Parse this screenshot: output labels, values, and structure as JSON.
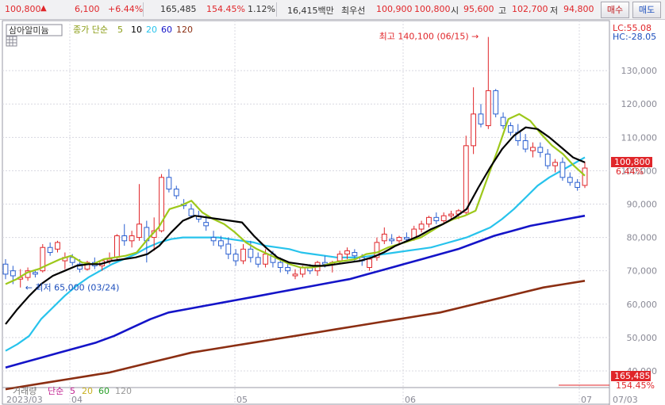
{
  "top_bar": {
    "price": "100,800",
    "up_arrow": "▲",
    "change": "6,100",
    "change_pct": "+6.44%",
    "volume": "165,485",
    "volume_ratio": "154.45%",
    "turnover": "1.12%",
    "trade_value": "16,415백만",
    "bid_label": "최우선",
    "ask1": "100,900",
    "bid1": "100,800",
    "open_label": "시",
    "open": "95,600",
    "high_label": "고",
    "high": "102,700",
    "low_label": "저",
    "low": "94,800",
    "buy_button": "매수",
    "sell_button": "매도"
  },
  "toolbar": {
    "name_chip": "삼아알미늄",
    "ma_label": "종가 단순",
    "ma_periods": [
      "5",
      "10",
      "20",
      "60",
      "120"
    ],
    "lc": "LC:55.08",
    "hc": "HC:-28.05"
  },
  "colors": {
    "up": "#e0262a",
    "down": "#2a5fd0",
    "ma5": "#9dc81a",
    "ma10": "#000000",
    "ma20": "#27c3ec",
    "ma60": "#1414c8",
    "ma120": "#8b2e12",
    "price_box": "#e0262a"
  },
  "chart_data": {
    "type": "candlestick",
    "y_ticks": [
      "130,000",
      "120,000",
      "110,000",
      "100,000",
      "90,000",
      "80,000",
      "70,000",
      "60,000",
      "50,000",
      "40,000"
    ],
    "ylim": [
      35000,
      145000
    ],
    "x_ticks": [
      "2023/03",
      "04",
      "05",
      "06",
      "07"
    ],
    "date_range": "2023/03 - 2023/07",
    "annotations": {
      "high": "최고 140,100 (06/15)",
      "low": "최저 65,000 (03/24)"
    },
    "current_price_label": "100,800",
    "current_change_label": "6.44%",
    "candles": [
      {
        "o": 72000,
        "h": 73500,
        "l": 67500,
        "c": 69000
      },
      {
        "o": 70000,
        "h": 71500,
        "l": 66000,
        "c": 68500
      },
      {
        "o": 67500,
        "h": 70500,
        "l": 65000,
        "c": 68000
      },
      {
        "o": 68000,
        "h": 71000,
        "l": 67000,
        "c": 70000
      },
      {
        "o": 69500,
        "h": 70500,
        "l": 68000,
        "c": 69000
      },
      {
        "o": 70000,
        "h": 78000,
        "l": 69500,
        "c": 77000
      },
      {
        "o": 77000,
        "h": 78500,
        "l": 74500,
        "c": 75500
      },
      {
        "o": 76500,
        "h": 79000,
        "l": 75500,
        "c": 78500
      },
      {
        "o": 73000,
        "h": 75500,
        "l": 70500,
        "c": 74000
      },
      {
        "o": 74000,
        "h": 75000,
        "l": 71500,
        "c": 72500
      },
      {
        "o": 72000,
        "h": 73500,
        "l": 69500,
        "c": 70500
      },
      {
        "o": 70500,
        "h": 73000,
        "l": 70000,
        "c": 72500
      },
      {
        "o": 72500,
        "h": 74000,
        "l": 70500,
        "c": 71500
      },
      {
        "o": 71500,
        "h": 73500,
        "l": 70000,
        "c": 73000
      },
      {
        "o": 73000,
        "h": 75500,
        "l": 72000,
        "c": 73500
      },
      {
        "o": 74000,
        "h": 81000,
        "l": 73500,
        "c": 80500
      },
      {
        "o": 80500,
        "h": 84000,
        "l": 77500,
        "c": 79000
      },
      {
        "o": 79000,
        "h": 82000,
        "l": 77000,
        "c": 80500
      },
      {
        "o": 80000,
        "h": 96000,
        "l": 79000,
        "c": 84000
      },
      {
        "o": 83000,
        "h": 85000,
        "l": 72500,
        "c": 79000
      },
      {
        "o": 80000,
        "h": 86000,
        "l": 76000,
        "c": 82000
      },
      {
        "o": 82000,
        "h": 99000,
        "l": 81500,
        "c": 98000
      },
      {
        "o": 98000,
        "h": 100500,
        "l": 93500,
        "c": 94500
      },
      {
        "o": 94500,
        "h": 95500,
        "l": 91500,
        "c": 92500
      },
      {
        "o": 90000,
        "h": 91500,
        "l": 88500,
        "c": 89500
      },
      {
        "o": 88500,
        "h": 90000,
        "l": 86000,
        "c": 86500
      },
      {
        "o": 86500,
        "h": 88000,
        "l": 84500,
        "c": 85500
      },
      {
        "o": 84500,
        "h": 86500,
        "l": 82000,
        "c": 83500
      },
      {
        "o": 80000,
        "h": 82000,
        "l": 77500,
        "c": 79000
      },
      {
        "o": 79000,
        "h": 80500,
        "l": 76500,
        "c": 77500
      },
      {
        "o": 78000,
        "h": 80000,
        "l": 73500,
        "c": 75000
      },
      {
        "o": 75000,
        "h": 76500,
        "l": 71500,
        "c": 73000
      },
      {
        "o": 73000,
        "h": 78000,
        "l": 72000,
        "c": 76500
      },
      {
        "o": 76500,
        "h": 79000,
        "l": 72500,
        "c": 74000
      },
      {
        "o": 74000,
        "h": 75500,
        "l": 71000,
        "c": 72000
      },
      {
        "o": 72000,
        "h": 76500,
        "l": 71000,
        "c": 75000
      },
      {
        "o": 75000,
        "h": 76000,
        "l": 71000,
        "c": 72500
      },
      {
        "o": 72500,
        "h": 74000,
        "l": 69500,
        "c": 71000
      },
      {
        "o": 71000,
        "h": 72500,
        "l": 69000,
        "c": 70000
      },
      {
        "o": 68500,
        "h": 70500,
        "l": 67500,
        "c": 69000
      },
      {
        "o": 69000,
        "h": 71500,
        "l": 68000,
        "c": 71000
      },
      {
        "o": 71000,
        "h": 72000,
        "l": 69000,
        "c": 70000
      },
      {
        "o": 70000,
        "h": 73000,
        "l": 68500,
        "c": 72500
      },
      {
        "o": 72500,
        "h": 74500,
        "l": 71000,
        "c": 72000
      },
      {
        "o": 72000,
        "h": 73000,
        "l": 69500,
        "c": 72500
      },
      {
        "o": 73000,
        "h": 76000,
        "l": 72000,
        "c": 75000
      },
      {
        "o": 75000,
        "h": 77000,
        "l": 73500,
        "c": 76000
      },
      {
        "o": 75500,
        "h": 76500,
        "l": 73000,
        "c": 74500
      },
      {
        "o": 74000,
        "h": 75000,
        "l": 71500,
        "c": 73000
      },
      {
        "o": 71000,
        "h": 74000,
        "l": 70000,
        "c": 73500
      },
      {
        "o": 74000,
        "h": 80000,
        "l": 73000,
        "c": 78500
      },
      {
        "o": 79000,
        "h": 83000,
        "l": 78000,
        "c": 81000
      },
      {
        "o": 79500,
        "h": 81000,
        "l": 78000,
        "c": 79000
      },
      {
        "o": 79000,
        "h": 80500,
        "l": 78000,
        "c": 80000
      },
      {
        "o": 80000,
        "h": 81500,
        "l": 78500,
        "c": 79500
      },
      {
        "o": 79500,
        "h": 83500,
        "l": 79000,
        "c": 82500
      },
      {
        "o": 82500,
        "h": 85000,
        "l": 81500,
        "c": 84000
      },
      {
        "o": 84000,
        "h": 86500,
        "l": 83000,
        "c": 86000
      },
      {
        "o": 86000,
        "h": 87500,
        "l": 84000,
        "c": 85000
      },
      {
        "o": 85000,
        "h": 87500,
        "l": 84000,
        "c": 86500
      },
      {
        "o": 86500,
        "h": 88000,
        "l": 85000,
        "c": 87000
      },
      {
        "o": 87000,
        "h": 88500,
        "l": 85500,
        "c": 88000
      },
      {
        "o": 87500,
        "h": 110500,
        "l": 87000,
        "c": 107500
      },
      {
        "o": 107500,
        "h": 125000,
        "l": 105000,
        "c": 117000
      },
      {
        "o": 117000,
        "h": 120000,
        "l": 113000,
        "c": 114000
      },
      {
        "o": 113500,
        "h": 140100,
        "l": 112500,
        "c": 124000
      },
      {
        "o": 124000,
        "h": 124500,
        "l": 116000,
        "c": 117000
      },
      {
        "o": 116000,
        "h": 117500,
        "l": 112500,
        "c": 113500
      },
      {
        "o": 113500,
        "h": 114500,
        "l": 110500,
        "c": 111500
      },
      {
        "o": 111500,
        "h": 114000,
        "l": 107500,
        "c": 109000
      },
      {
        "o": 109000,
        "h": 111000,
        "l": 105500,
        "c": 106500
      },
      {
        "o": 106000,
        "h": 108500,
        "l": 104000,
        "c": 107000
      },
      {
        "o": 107000,
        "h": 108500,
        "l": 104000,
        "c": 105500
      },
      {
        "o": 105000,
        "h": 106500,
        "l": 100500,
        "c": 101500
      },
      {
        "o": 101500,
        "h": 103500,
        "l": 99500,
        "c": 102500
      },
      {
        "o": 102500,
        "h": 104000,
        "l": 97000,
        "c": 98000
      },
      {
        "o": 98000,
        "h": 99500,
        "l": 95500,
        "c": 96500
      },
      {
        "o": 96500,
        "h": 97500,
        "l": 94000,
        "c": 95000
      },
      {
        "o": 95600,
        "h": 102700,
        "l": 94800,
        "c": 100800
      }
    ],
    "ma_lines": [
      {
        "period": 5,
        "y": [
          66000,
          67500,
          69500,
          70500,
          72000,
          73500,
          74500,
          72500,
          72000,
          73500,
          74000,
          74500,
          75500,
          79500,
          83000,
          88500,
          89500,
          91000,
          87500,
          85500,
          84000,
          81500,
          78500,
          76500,
          75000,
          73500,
          72000,
          71000,
          71000,
          71500,
          72500,
          73000,
          73500,
          75000,
          75500,
          77000,
          78000,
          79000,
          80000,
          82000,
          84000,
          85500,
          86500,
          88000,
          97000,
          106000,
          115500,
          117000,
          115000,
          111000,
          107500,
          105000,
          101500,
          98500
        ]
      },
      {
        "period": 10,
        "y": [
          54000,
          58500,
          62500,
          66000,
          68500,
          70000,
          71500,
          72000,
          72000,
          73000,
          73500,
          74000,
          75000,
          77500,
          81500,
          85000,
          86500,
          86000,
          85500,
          85000,
          84500,
          80500,
          77000,
          74000,
          72500,
          72000,
          71500,
          71500,
          72000,
          72500,
          73000,
          74000,
          75500,
          77500,
          79000,
          80500,
          82500,
          84000,
          86000,
          88500,
          95000,
          101000,
          106500,
          110500,
          113000,
          112500,
          110000,
          107000,
          104000,
          102500
        ]
      },
      {
        "period": 20,
        "y": [
          46000,
          48000,
          50500,
          55500,
          59000,
          62500,
          65500,
          68000,
          70000,
          72000,
          73500,
          75000,
          77000,
          78500,
          79500,
          80000,
          80000,
          80000,
          80000,
          79500,
          79000,
          78500,
          77500,
          77000,
          76500,
          75500,
          75000,
          74500,
          74000,
          74000,
          74000,
          74500,
          75000,
          75500,
          76000,
          76500,
          77000,
          78000,
          79000,
          80000,
          81500,
          83000,
          85500,
          88500,
          92000,
          95500,
          98000,
          100000,
          102000,
          104000
        ]
      },
      {
        "period": 60,
        "y": [
          41000,
          42500,
          44000,
          45500,
          47000,
          48500,
          50500,
          53000,
          55500,
          57500,
          58500,
          59500,
          60500,
          61500,
          62500,
          63500,
          64500,
          65500,
          66500,
          67500,
          69000,
          70500,
          72000,
          73500,
          75000,
          76500,
          78500,
          80500,
          82000,
          83500,
          84500,
          85500,
          86500
        ]
      },
      {
        "period": 120,
        "y": [
          34500,
          35500,
          36500,
          37500,
          38500,
          39500,
          41000,
          42500,
          44000,
          45500,
          46500,
          47500,
          48500,
          49500,
          50500,
          51500,
          52500,
          53500,
          54500,
          55500,
          56500,
          57500,
          59000,
          60500,
          62000,
          63500,
          65000,
          66000,
          67000
        ]
      }
    ],
    "volume_panel": {
      "label": "거래량",
      "ma_label": "단순",
      "periods": [
        "5",
        "20",
        "60",
        "120"
      ],
      "last_volume": "165,485",
      "last_volume_pct": "154.45%"
    }
  }
}
